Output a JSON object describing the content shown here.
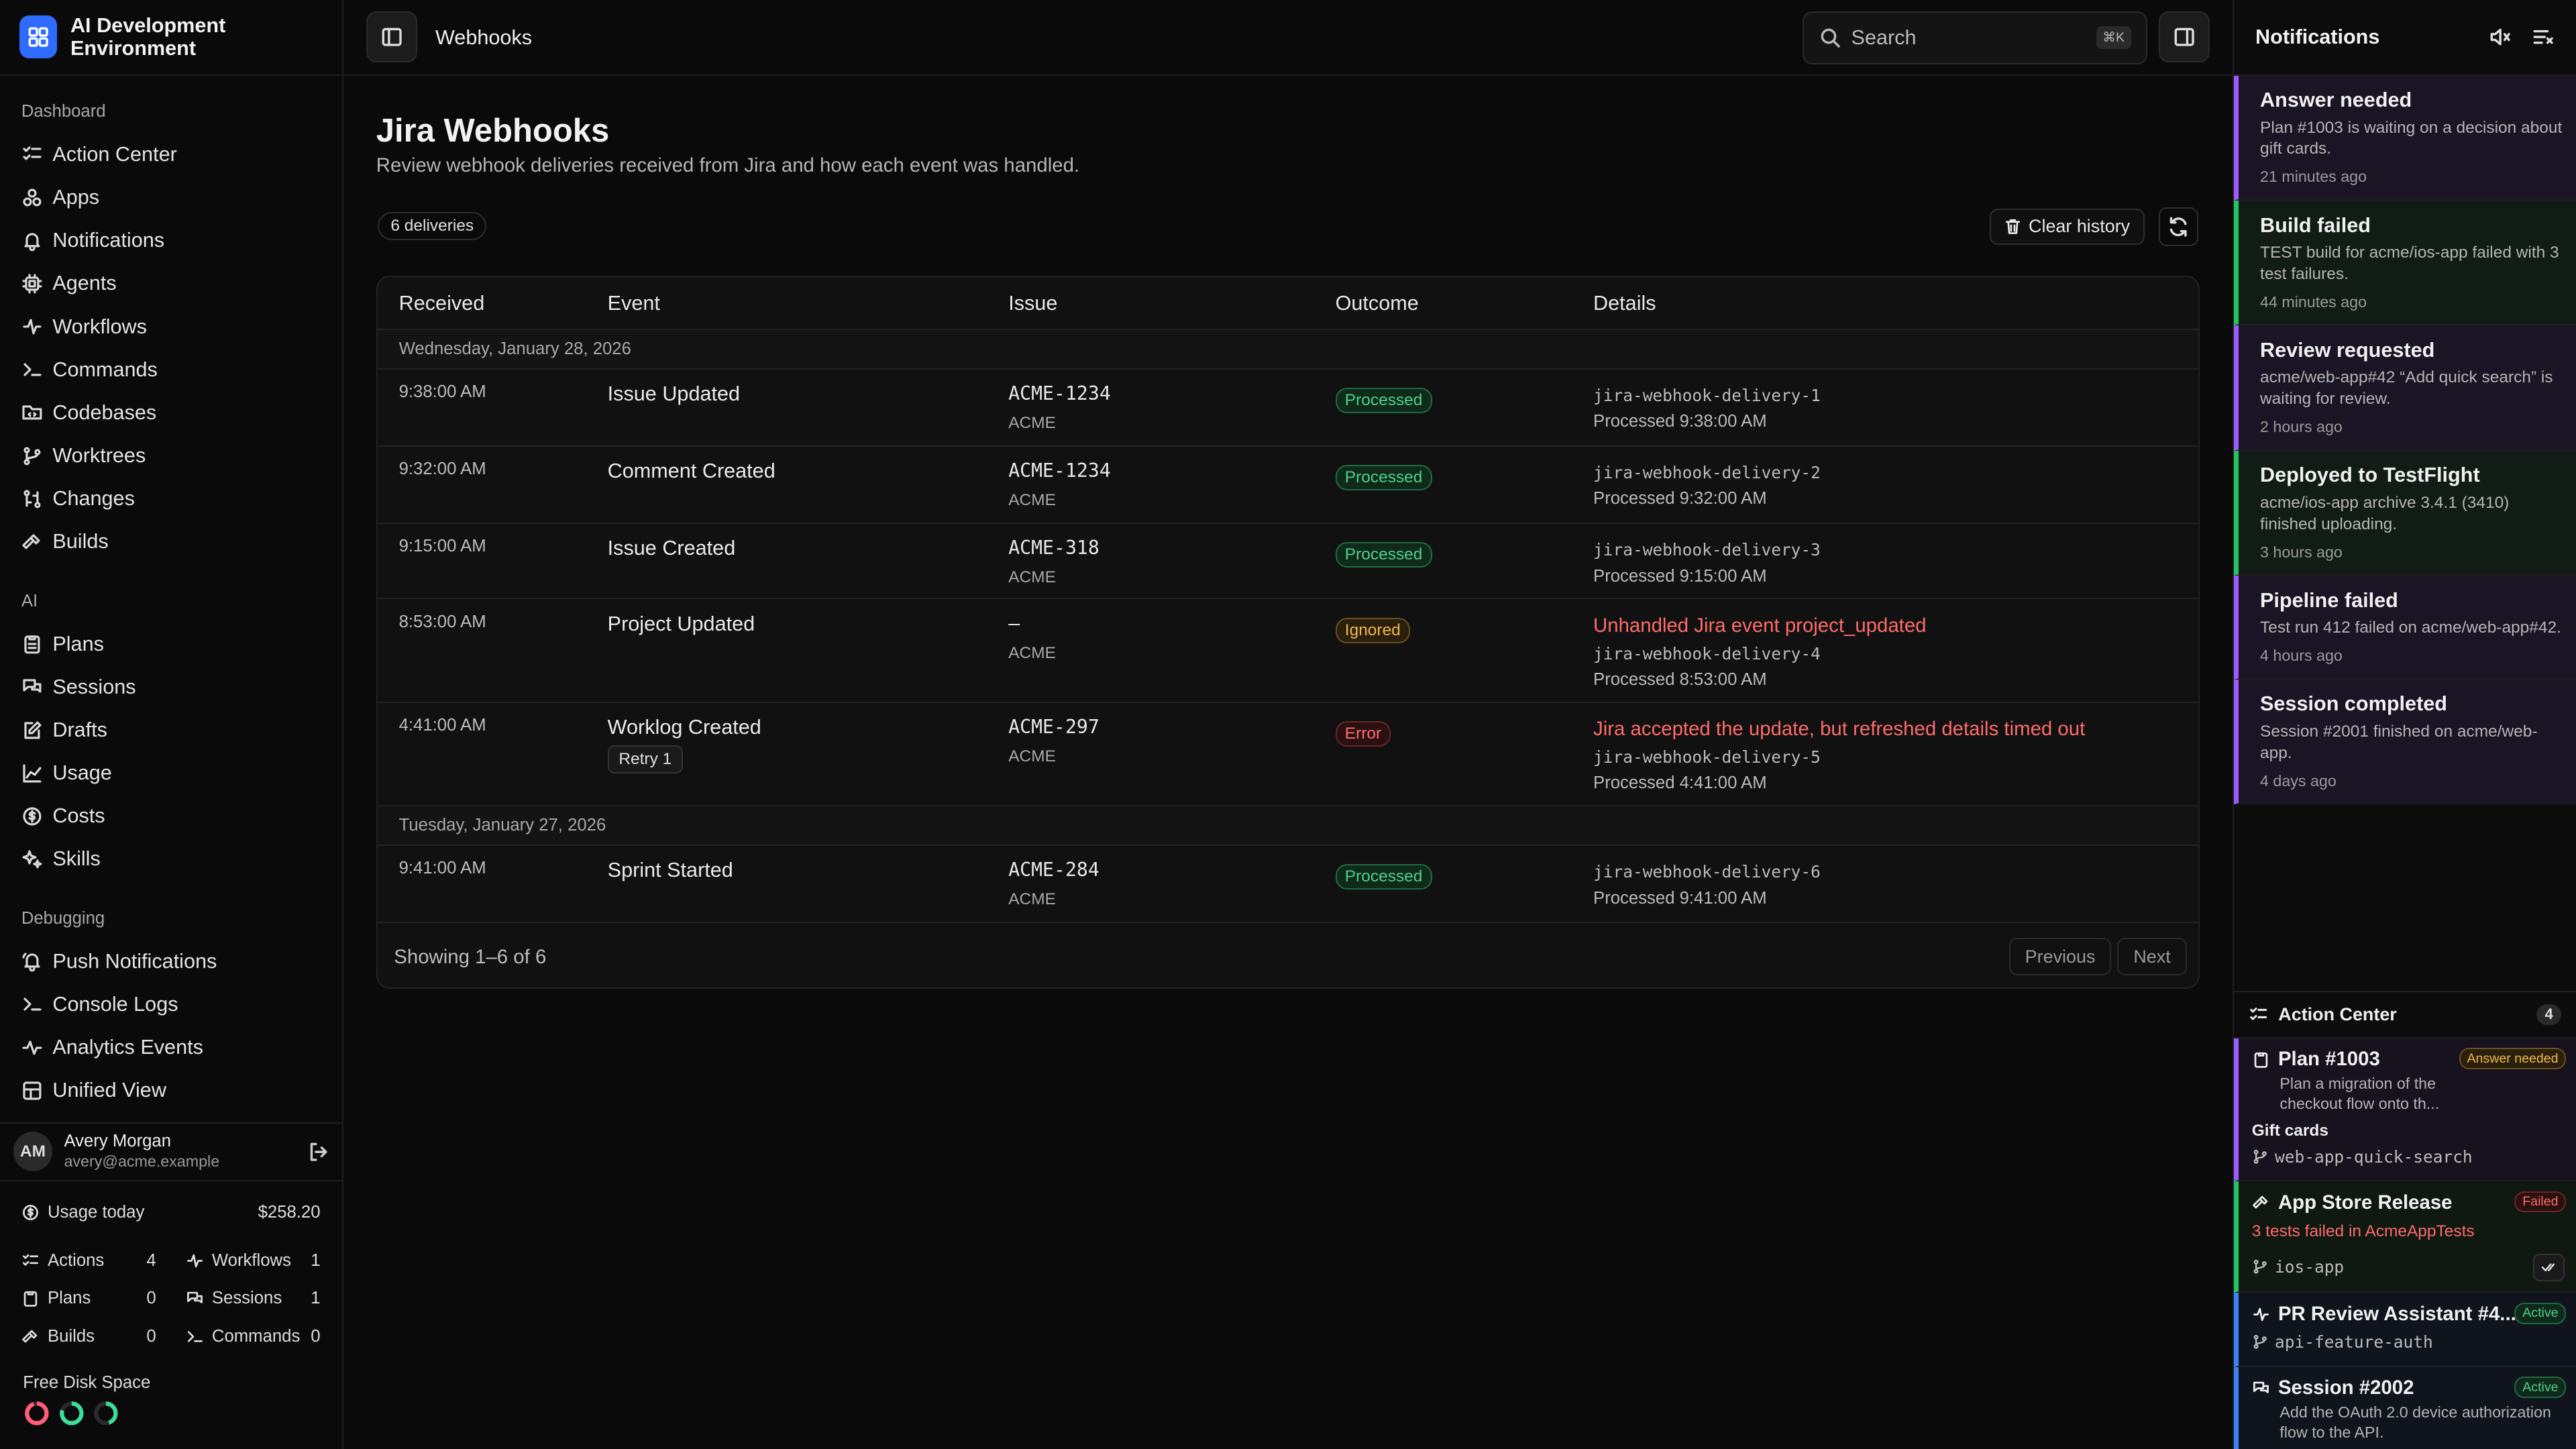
{
  "app": {
    "title": "AI Development Environment"
  },
  "sidebar": {
    "groups": [
      {
        "heading": "Dashboard",
        "items": [
          "Action Center",
          "Apps",
          "Notifications",
          "Agents",
          "Workflows",
          "Commands",
          "Codebases",
          "Worktrees",
          "Changes",
          "Builds"
        ]
      },
      {
        "heading": "AI",
        "items": [
          "Plans",
          "Sessions",
          "Drafts",
          "Usage",
          "Costs",
          "Skills"
        ]
      },
      {
        "heading": "Debugging",
        "items": [
          "Push Notifications",
          "Console Logs",
          "Analytics Events",
          "Unified View"
        ]
      }
    ],
    "user": {
      "initials": "AM",
      "name": "Avery Morgan",
      "email": "avery@acme.example"
    },
    "usage": {
      "label": "Usage today",
      "amount": "$258.20",
      "stats": [
        {
          "label": "Actions",
          "value": "4"
        },
        {
          "label": "Workflows",
          "value": "1"
        },
        {
          "label": "Plans",
          "value": "0"
        },
        {
          "label": "Sessions",
          "value": "1"
        },
        {
          "label": "Builds",
          "value": "0"
        },
        {
          "label": "Commands",
          "value": "0"
        }
      ]
    },
    "disk": {
      "label": "Free Disk Space",
      "rings": [
        {
          "color": "#ff5c7a",
          "fraction": 0.95
        },
        {
          "color": "#3ddc97",
          "fraction": 0.8
        },
        {
          "color": "#3ddc97",
          "fraction": 0.45
        }
      ]
    }
  },
  "header": {
    "title": "Webhooks",
    "search_placeholder": "Search",
    "shortcut": "⌘K"
  },
  "main": {
    "title": "Jira Webhooks",
    "subtitle": "Review webhook deliveries received from Jira and how each event was handled.",
    "count_label": "6 deliveries",
    "clear_label": "Clear history",
    "columns": [
      "Received",
      "Event",
      "Issue",
      "Outcome",
      "Details"
    ],
    "date_groups": [
      "Wednesday, January 28, 2026",
      "Tuesday, January 27, 2026"
    ],
    "rows": [
      {
        "time": "9:38:00 AM",
        "event": "Issue Updated",
        "issue": "ACME-1234",
        "project": "ACME",
        "outcome": "Processed",
        "delivery": "jira-webhook-delivery-1",
        "processed": "Processed 9:38:00 AM"
      },
      {
        "time": "9:32:00 AM",
        "event": "Comment Created",
        "issue": "ACME-1234",
        "project": "ACME",
        "outcome": "Processed",
        "delivery": "jira-webhook-delivery-2",
        "processed": "Processed 9:32:00 AM"
      },
      {
        "time": "9:15:00 AM",
        "event": "Issue Created",
        "issue": "ACME-318",
        "project": "ACME",
        "outcome": "Processed",
        "delivery": "jira-webhook-delivery-3",
        "processed": "Processed 9:15:00 AM"
      },
      {
        "time": "8:53:00 AM",
        "event": "Project Updated",
        "issue": "–",
        "project": "ACME",
        "outcome": "Ignored",
        "error": "Unhandled Jira event project_updated",
        "delivery": "jira-webhook-delivery-4",
        "processed": "Processed 8:53:00 AM"
      },
      {
        "time": "4:41:00 AM",
        "event": "Worklog Created",
        "retry": "Retry 1",
        "issue": "ACME-297",
        "project": "ACME",
        "outcome": "Error",
        "error": "Jira accepted the update, but refreshed details timed out",
        "delivery": "jira-webhook-delivery-5",
        "processed": "Processed 4:41:00 AM"
      },
      {
        "time": "9:41:00 AM",
        "event": "Sprint Started",
        "issue": "ACME-284",
        "project": "ACME",
        "outcome": "Processed",
        "delivery": "jira-webhook-delivery-6",
        "processed": "Processed 9:41:00 AM"
      }
    ],
    "pagination": {
      "showing": "Showing 1–6 of 6",
      "previous": "Previous",
      "next": "Next"
    }
  },
  "notifications": {
    "title": "Notifications",
    "items": [
      {
        "title": "Answer needed",
        "desc": "Plan #1003 is waiting on a decision about gift cards.",
        "ago": "21 minutes ago",
        "color": "#9b5cff"
      },
      {
        "title": "Build failed",
        "desc": "TEST build for acme/ios-app failed with 3 test failures.",
        "ago": "44 minutes ago",
        "color": "#22c55e"
      },
      {
        "title": "Review requested",
        "desc": "acme/web-app#42 “Add quick search” is waiting for review.",
        "ago": "2 hours ago",
        "color": "#9b5cff"
      },
      {
        "title": "Deployed to TestFlight",
        "desc": "acme/ios-app archive 3.4.1 (3410) finished uploading.",
        "ago": "3 hours ago",
        "color": "#22c55e"
      },
      {
        "title": "Pipeline failed",
        "desc": "Test run 412 failed on acme/web-app#42.",
        "ago": "4 hours ago",
        "color": "#9b5cff"
      },
      {
        "title": "Session completed",
        "desc": "Session #2001 finished on acme/web-app.",
        "ago": "4 days ago",
        "color": "#9b5cff"
      }
    ]
  },
  "action_center": {
    "title": "Action Center",
    "count": "4",
    "items": [
      {
        "title": "Plan #1003",
        "tag": "Answer needed",
        "desc": "Plan a migration of the checkout flow onto th...",
        "extra": "Gift cards",
        "branch": "web-app-quick-search",
        "color": "#9b5cff"
      },
      {
        "title": "App Store Release",
        "tag": "Failed",
        "error": "3 tests failed in AcmeAppTests",
        "branch": "ios-app",
        "color": "#22c55e"
      },
      {
        "title": "PR Review Assistant #4...",
        "tag": "Active",
        "branch": "api-feature-auth",
        "color": "#3b82f6"
      },
      {
        "title": "Session #2002",
        "tag": "Active",
        "desc": "Add the OAuth 2.0 device authorization flow to the API.",
        "color": "#3b82f6"
      }
    ]
  }
}
